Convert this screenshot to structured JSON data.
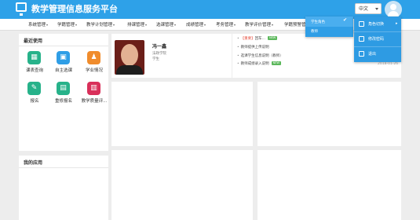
{
  "header": {
    "app_title": "教学管理信息服务平台",
    "language": "中文"
  },
  "nav": {
    "items": [
      {
        "label": "系统管理"
      },
      {
        "label": "学籍管理"
      },
      {
        "label": "教学计划管理"
      },
      {
        "label": "排课管理"
      },
      {
        "label": "选课管理"
      },
      {
        "label": "成绩管理"
      },
      {
        "label": "考务管理"
      },
      {
        "label": "教学评价管理"
      },
      {
        "label": "学籍预警管理"
      }
    ]
  },
  "recent": {
    "title": "最近使用",
    "items": [
      {
        "label": "课表查询",
        "icon": "calendar-icon",
        "color": "#27b28a"
      },
      {
        "label": "自主选课",
        "icon": "select-course-icon",
        "color": "#2f9ee6"
      },
      {
        "label": "学业情况",
        "icon": "person-icon",
        "color": "#f08c2c"
      },
      {
        "label": "报名",
        "icon": "signup-icon",
        "color": "#27b28a"
      },
      {
        "label": "重修报名",
        "icon": "retake-icon",
        "color": "#27b28a"
      },
      {
        "label": "教学质量评...",
        "icon": "evaluation-icon",
        "color": "#d9305a"
      }
    ]
  },
  "my_apps": {
    "title": "我的应用"
  },
  "profile": {
    "name": "冯一鑫",
    "department": "法政学院",
    "role": "学生"
  },
  "notices": [
    {
      "tag": "【重要】",
      "text": "回车..."
    },
    {
      "tag": "",
      "text": "教师提供上传说明"
    },
    {
      "tag": "",
      "text": "选课学生信息说明（教师）"
    },
    {
      "tag": "",
      "text": "教师成绩录入说明"
    }
  ],
  "notice_new_label": "NEW",
  "notice_date": "2018-01-26",
  "role_dropdown": {
    "items": [
      {
        "label": "学生角色",
        "selected": true
      },
      {
        "label": "教师",
        "selected": false
      }
    ]
  },
  "user_menu": {
    "items": [
      {
        "label": "角色切换",
        "icon": "switch-icon",
        "has_submenu": true
      },
      {
        "label": "修改密码",
        "icon": "edit-icon",
        "has_submenu": false
      },
      {
        "label": "退出",
        "icon": "logout-icon",
        "has_submenu": false
      }
    ]
  },
  "colors": {
    "header_blue": "#2ea1e8",
    "menu_blue": "#2e9be3",
    "important_red": "#e64c3c",
    "new_badge_green": "#5cb85c"
  }
}
